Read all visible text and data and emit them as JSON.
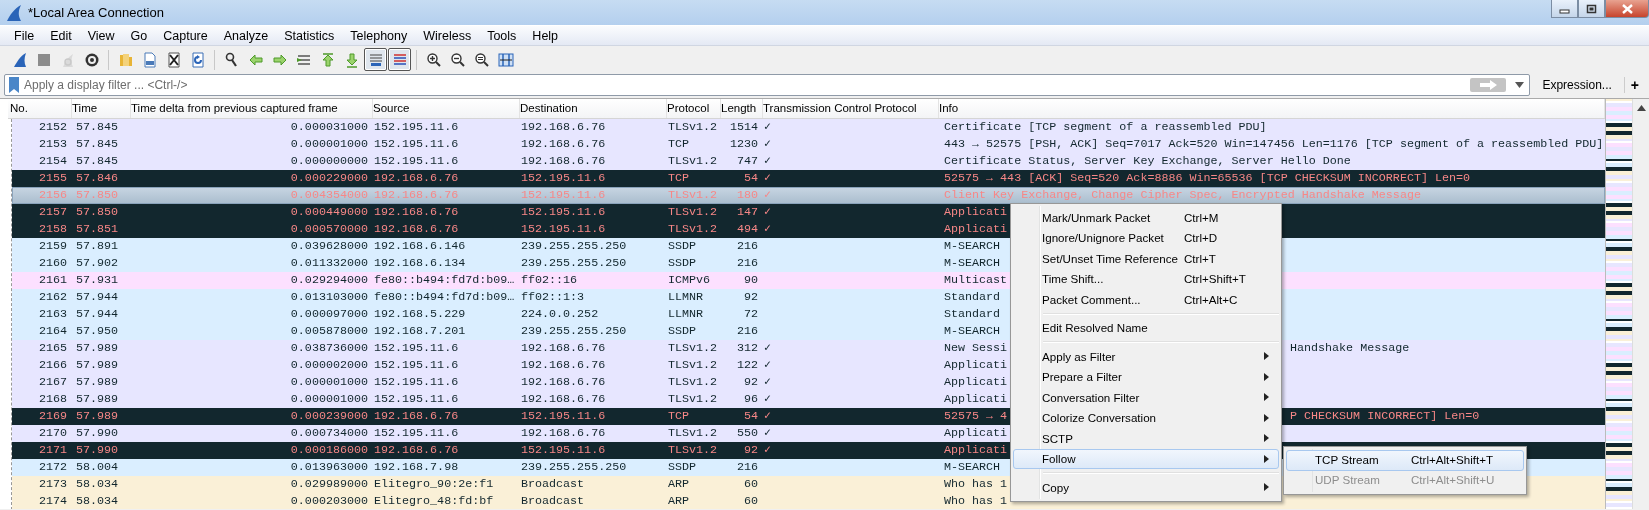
{
  "window": {
    "title": "*Local Area Connection"
  },
  "menu_bar": [
    "File",
    "Edit",
    "View",
    "Go",
    "Capture",
    "Analyze",
    "Statistics",
    "Telephony",
    "Wireless",
    "Tools",
    "Help"
  ],
  "toolbar": [
    {
      "kind": "fin",
      "pressed": false,
      "disabled": false
    },
    {
      "kind": "stop",
      "pressed": false,
      "disabled": false
    },
    {
      "kind": "restart",
      "pressed": false,
      "disabled": true
    },
    {
      "kind": "options",
      "pressed": false,
      "disabled": false
    },
    {
      "kind": "separator"
    },
    {
      "kind": "open",
      "pressed": false,
      "disabled": false
    },
    {
      "kind": "save",
      "pressed": false,
      "disabled": false
    },
    {
      "kind": "close",
      "pressed": false,
      "disabled": false
    },
    {
      "kind": "reload",
      "pressed": false,
      "disabled": false
    },
    {
      "kind": "separator"
    },
    {
      "kind": "find",
      "pressed": false,
      "disabled": false
    },
    {
      "kind": "back",
      "pressed": false,
      "disabled": false
    },
    {
      "kind": "forward",
      "pressed": false,
      "disabled": false
    },
    {
      "kind": "goto",
      "pressed": false,
      "disabled": false
    },
    {
      "kind": "first",
      "pressed": false,
      "disabled": false
    },
    {
      "kind": "last",
      "pressed": false,
      "disabled": false
    },
    {
      "kind": "autoscroll",
      "pressed": true,
      "disabled": false
    },
    {
      "kind": "colorize",
      "pressed": true,
      "disabled": false
    },
    {
      "kind": "separator"
    },
    {
      "kind": "zoom-in",
      "pressed": false,
      "disabled": false
    },
    {
      "kind": "zoom-out",
      "pressed": false,
      "disabled": false
    },
    {
      "kind": "zoom-reset",
      "pressed": false,
      "disabled": false
    },
    {
      "kind": "resize",
      "pressed": false,
      "disabled": false
    }
  ],
  "filter": {
    "placeholder": "Apply a display filter ... <Ctrl-/>",
    "expression_button": "Expression...",
    "add_button": "+"
  },
  "columns": [
    "No.",
    "Time",
    "Time delta from previous captured frame",
    "Source",
    "Destination",
    "Protocol",
    "Length",
    "Transmission Control Protocol",
    "Info"
  ],
  "packets": [
    {
      "no": "2152",
      "time": "57.845",
      "delta": "0.000031000",
      "source": "152.195.11.6",
      "destination": "192.168.6.76",
      "protocol": "TLSv1.2",
      "length": "1514",
      "tcp": "✓",
      "info": "Certificate [TCP segment of a reassembled PDU]",
      "kind": "tcp",
      "selected": false
    },
    {
      "no": "2153",
      "time": "57.845",
      "delta": "0.000001000",
      "source": "152.195.11.6",
      "destination": "192.168.6.76",
      "protocol": "TCP",
      "length": "1230",
      "tcp": "✓",
      "info": "443 → 52575 [PSH, ACK] Seq=7017 Ack=520 Win=147456 Len=1176 [TCP segment of a reassembled PDU]",
      "kind": "tcp",
      "selected": false
    },
    {
      "no": "2154",
      "time": "57.845",
      "delta": "0.000000000",
      "source": "152.195.11.6",
      "destination": "192.168.6.76",
      "protocol": "TLSv1.2",
      "length": "747",
      "tcp": "✓",
      "info": "Certificate Status, Server Key Exchange, Server Hello Done",
      "kind": "tcp",
      "selected": false
    },
    {
      "no": "2155",
      "time": "57.846",
      "delta": "0.000229000",
      "source": "192.168.6.76",
      "destination": "152.195.11.6",
      "protocol": "TCP",
      "length": "54",
      "tcp": "✓",
      "info": "52575 → 443 [ACK] Seq=520 Ack=8886 Win=65536 [TCP CHECKSUM INCORRECT] Len=0",
      "kind": "bad",
      "selected": false
    },
    {
      "no": "2156",
      "time": "57.850",
      "delta": "0.004354000",
      "source": "192.168.6.76",
      "destination": "152.195.11.6",
      "protocol": "TLSv1.2",
      "length": "180",
      "tcp": "✓",
      "info": "Client Key Exchange, Change Cipher Spec, Encrypted Handshake Message",
      "kind": "bad",
      "selected": true
    },
    {
      "no": "2157",
      "time": "57.850",
      "delta": "0.000449000",
      "source": "192.168.6.76",
      "destination": "152.195.11.6",
      "protocol": "TLSv1.2",
      "length": "147",
      "tcp": "✓",
      "info": "Applicati",
      "kind": "bad",
      "selected": false
    },
    {
      "no": "2158",
      "time": "57.851",
      "delta": "0.000570000",
      "source": "192.168.6.76",
      "destination": "152.195.11.6",
      "protocol": "TLSv1.2",
      "length": "494",
      "tcp": "✓",
      "info": "Applicati",
      "kind": "bad",
      "selected": false
    },
    {
      "no": "2159",
      "time": "57.891",
      "delta": "0.039628000",
      "source": "192.168.6.146",
      "destination": "239.255.255.250",
      "protocol": "SSDP",
      "length": "216",
      "info": "M-SEARCH",
      "kind": "udp",
      "selected": false
    },
    {
      "no": "2160",
      "time": "57.902",
      "delta": "0.011332000",
      "source": "192.168.6.134",
      "destination": "239.255.255.250",
      "protocol": "SSDP",
      "length": "216",
      "info": "M-SEARCH",
      "kind": "udp",
      "selected": false
    },
    {
      "no": "2161",
      "time": "57.931",
      "delta": "0.029294000",
      "source": "fe80::b494:fd7d:b09…",
      "destination": "ff02::16",
      "protocol": "ICMPv6",
      "length": "90",
      "info": "Multicast",
      "kind": "icmp",
      "selected": false
    },
    {
      "no": "2162",
      "time": "57.944",
      "delta": "0.013103000",
      "source": "fe80::b494:fd7d:b09…",
      "destination": "ff02::1:3",
      "protocol": "LLMNR",
      "length": "92",
      "info": "Standard",
      "kind": "udp",
      "selected": false
    },
    {
      "no": "2163",
      "time": "57.944",
      "delta": "0.000097000",
      "source": "192.168.5.229",
      "destination": "224.0.0.252",
      "protocol": "LLMNR",
      "length": "72",
      "info": "Standard",
      "kind": "udp",
      "selected": false
    },
    {
      "no": "2164",
      "time": "57.950",
      "delta": "0.005878000",
      "source": "192.168.7.201",
      "destination": "239.255.255.250",
      "protocol": "SSDP",
      "length": "216",
      "info": "M-SEARCH",
      "kind": "udp",
      "selected": false
    },
    {
      "no": "2165",
      "time": "57.989",
      "delta": "0.038736000",
      "source": "152.195.11.6",
      "destination": "192.168.6.76",
      "protocol": "TLSv1.2",
      "length": "312",
      "tcp": "✓",
      "info": "New Sessi",
      "info_tail": "Handshake Message",
      "kind": "tcp",
      "selected": false
    },
    {
      "no": "2166",
      "time": "57.989",
      "delta": "0.000002000",
      "source": "152.195.11.6",
      "destination": "192.168.6.76",
      "protocol": "TLSv1.2",
      "length": "122",
      "tcp": "✓",
      "info": "Applicati",
      "kind": "tcp",
      "selected": false
    },
    {
      "no": "2167",
      "time": "57.989",
      "delta": "0.000001000",
      "source": "152.195.11.6",
      "destination": "192.168.6.76",
      "protocol": "TLSv1.2",
      "length": "92",
      "tcp": "✓",
      "info": "Applicati",
      "kind": "tcp",
      "selected": false
    },
    {
      "no": "2168",
      "time": "57.989",
      "delta": "0.000001000",
      "source": "152.195.11.6",
      "destination": "192.168.6.76",
      "protocol": "TLSv1.2",
      "length": "96",
      "tcp": "✓",
      "info": "Applicati",
      "kind": "tcp",
      "selected": false
    },
    {
      "no": "2169",
      "time": "57.989",
      "delta": "0.000239000",
      "source": "192.168.6.76",
      "destination": "152.195.11.6",
      "protocol": "TCP",
      "length": "54",
      "tcp": "✓",
      "info": "52575 → 4",
      "info_tail": "P CHECKSUM INCORRECT] Len=0",
      "kind": "bad",
      "selected": false
    },
    {
      "no": "2170",
      "time": "57.990",
      "delta": "0.000734000",
      "source": "152.195.11.6",
      "destination": "192.168.6.76",
      "protocol": "TLSv1.2",
      "length": "550",
      "tcp": "✓",
      "info": "Applicati",
      "kind": "tcp",
      "selected": false
    },
    {
      "no": "2171",
      "time": "57.990",
      "delta": "0.000186000",
      "source": "192.168.6.76",
      "destination": "152.195.11.6",
      "protocol": "TLSv1.2",
      "length": "92",
      "tcp": "✓",
      "info": "Applicati",
      "kind": "bad",
      "selected": false
    },
    {
      "no": "2172",
      "time": "58.004",
      "delta": "0.013963000",
      "source": "192.168.7.98",
      "destination": "239.255.255.250",
      "protocol": "SSDP",
      "length": "216",
      "info": "M-SEARCH",
      "kind": "udp",
      "selected": false
    },
    {
      "no": "2173",
      "time": "58.034",
      "delta": "0.029989000",
      "source": "Elitegro_90:2e:f1",
      "destination": "Broadcast",
      "protocol": "ARP",
      "length": "60",
      "info": "Who has 1",
      "kind": "arp",
      "selected": false
    },
    {
      "no": "2174",
      "time": "58.034",
      "delta": "0.000203000",
      "source": "Elitegro_48:fd:bf",
      "destination": "Broadcast",
      "protocol": "ARP",
      "length": "60",
      "info": "Who has 1",
      "kind": "arp",
      "selected": false
    }
  ],
  "context_menu": [
    {
      "kind": "item",
      "label": "Mark/Unmark Packet",
      "shortcut": "Ctrl+M",
      "selected": false,
      "disabled": false
    },
    {
      "kind": "item",
      "label": "Ignore/Unignore Packet",
      "shortcut": "Ctrl+D",
      "selected": false,
      "disabled": false
    },
    {
      "kind": "item",
      "label": "Set/Unset Time Reference",
      "shortcut": "Ctrl+T",
      "selected": false,
      "disabled": false
    },
    {
      "kind": "item",
      "label": "Time Shift...",
      "shortcut": "Ctrl+Shift+T",
      "selected": false,
      "disabled": false
    },
    {
      "kind": "item",
      "label": "Packet Comment...",
      "shortcut": "Ctrl+Alt+C",
      "selected": false,
      "disabled": false
    },
    {
      "kind": "separator"
    },
    {
      "kind": "item",
      "label": "Edit Resolved Name",
      "selected": false,
      "disabled": false
    },
    {
      "kind": "separator"
    },
    {
      "kind": "submenu",
      "label": "Apply as Filter",
      "selected": false,
      "disabled": false
    },
    {
      "kind": "submenu",
      "label": "Prepare a Filter",
      "selected": false,
      "disabled": false
    },
    {
      "kind": "submenu",
      "label": "Conversation Filter",
      "selected": false,
      "disabled": false
    },
    {
      "kind": "submenu",
      "label": "Colorize Conversation",
      "selected": false,
      "disabled": false
    },
    {
      "kind": "submenu",
      "label": "SCTP",
      "selected": false,
      "disabled": false
    },
    {
      "kind": "submenu",
      "label": "Follow",
      "selected": true,
      "disabled": false
    },
    {
      "kind": "separator"
    },
    {
      "kind": "submenu",
      "label": "Copy",
      "selected": false,
      "disabled": false
    }
  ],
  "follow_submenu": [
    {
      "kind": "item",
      "label": "TCP Stream",
      "shortcut": "Ctrl+Alt+Shift+T",
      "selected": true,
      "disabled": false
    },
    {
      "kind": "item",
      "label": "UDP Stream",
      "shortcut": "Ctrl+Alt+Shift+U",
      "selected": false,
      "disabled": true
    }
  ]
}
